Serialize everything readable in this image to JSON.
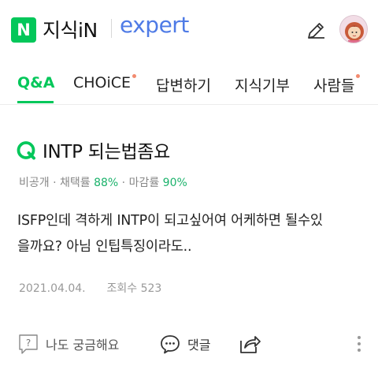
{
  "header": {
    "logo_letter": "N",
    "logo_text": "지식iN",
    "expert_text": "expert"
  },
  "tabs": [
    {
      "label": "Q&A",
      "active": true,
      "new_dot": false
    },
    {
      "label": "CHOiCE",
      "active": false,
      "new_dot": true
    },
    {
      "label": "답변하기",
      "active": false,
      "new_dot": false
    },
    {
      "label": "지식기부",
      "active": false,
      "new_dot": false
    },
    {
      "label": "사람들",
      "active": false,
      "new_dot": true
    }
  ],
  "question": {
    "title": "INTP 되는법좀요",
    "meta": {
      "visibility": "비공개",
      "adoption_label": "채택률",
      "adoption_rate": "88%",
      "deadline_label": "마감률",
      "deadline_rate": "90%"
    },
    "body_line1": "ISFP인데 격하게 INTP이 되고싶어여 어케하면 될수있",
    "body_line2": "을까요? 아님 인팁특징이라도..",
    "date": "2021.04.04.",
    "views_label": "조회수",
    "views": "523"
  },
  "actions": {
    "curious_label": "나도 궁금해요",
    "comment_label": "댓글"
  },
  "colors": {
    "brand_green": "#03c75a",
    "expert_blue": "#4f7be6",
    "new_dot": "#f28b6f"
  }
}
